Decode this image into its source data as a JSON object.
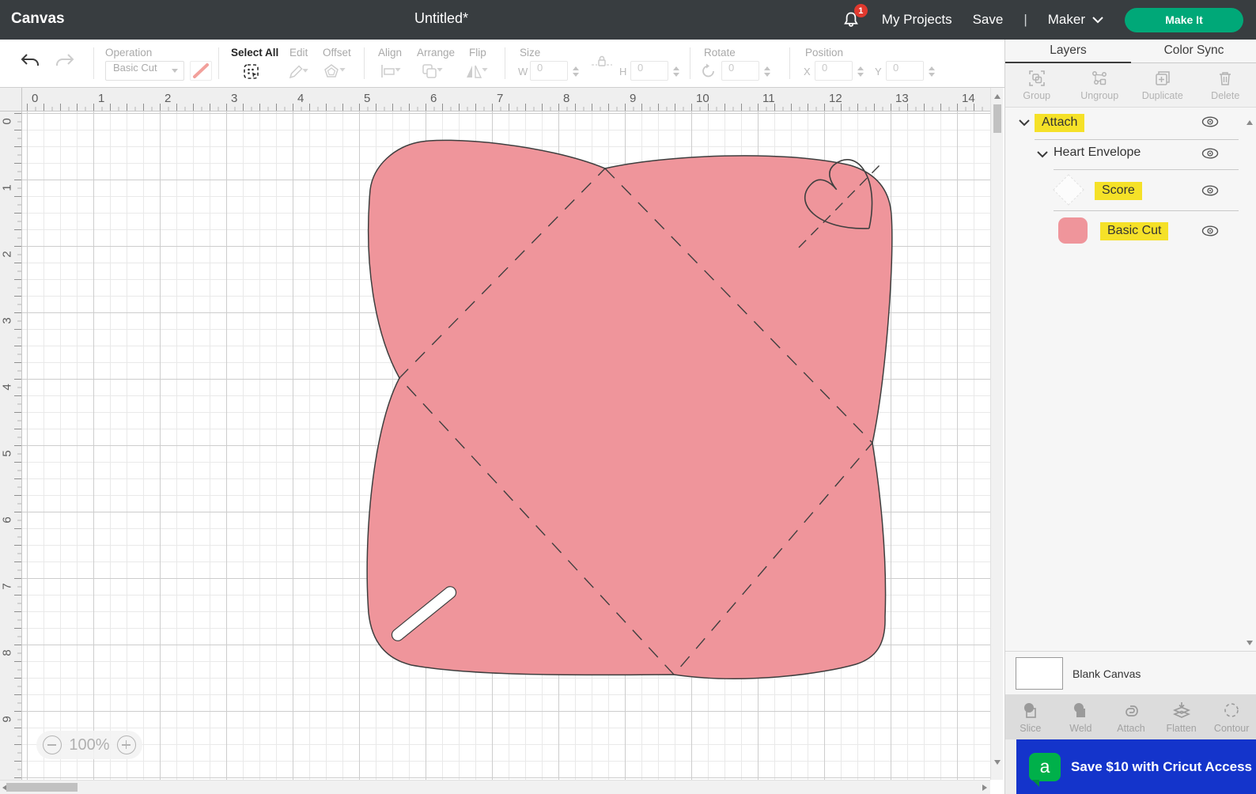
{
  "header": {
    "app_title": "Canvas",
    "doc_title": "Untitled*",
    "notification_count": "1",
    "my_projects": "My Projects",
    "save": "Save",
    "separator": "|",
    "machine_name": "Maker",
    "make_it": "Make It"
  },
  "toolbar": {
    "operation_label": "Operation",
    "operation_value": "Basic Cut",
    "select_all": "Select All",
    "edit": "Edit",
    "offset": "Offset",
    "align": "Align",
    "arrange": "Arrange",
    "flip": "Flip",
    "size_label": "Size",
    "w_label": "W",
    "w_value": "0",
    "h_label": "H",
    "h_value": "0",
    "rotate_label": "Rotate",
    "rotate_value": "0",
    "position_label": "Position",
    "x_label": "X",
    "x_value": "0",
    "y_label": "Y",
    "y_value": "0"
  },
  "canvas": {
    "zoom_level": "100%",
    "ruler_h": [
      "0",
      "1",
      "2",
      "3",
      "4",
      "5",
      "6",
      "7",
      "8",
      "9",
      "10",
      "11",
      "12",
      "13",
      "14"
    ],
    "ruler_v": [
      "0",
      "1",
      "2",
      "3",
      "4",
      "5",
      "6",
      "7",
      "8",
      "9"
    ],
    "object_name": "Heart Envelope"
  },
  "panel": {
    "tabs": [
      {
        "label": "Layers"
      },
      {
        "label": "Color Sync"
      }
    ],
    "actions": [
      {
        "label": "Group"
      },
      {
        "label": "Ungroup"
      },
      {
        "label": "Duplicate"
      },
      {
        "label": "Delete"
      }
    ],
    "layers": [
      {
        "label": "Attach",
        "highlighted": true
      },
      {
        "label": "Heart Envelope",
        "highlighted": false
      },
      {
        "label": "Score",
        "highlighted": true
      },
      {
        "label": "Basic Cut",
        "highlighted": true
      }
    ],
    "blank_canvas": "Blank Canvas",
    "tools": [
      {
        "label": "Slice"
      },
      {
        "label": "Weld"
      },
      {
        "label": "Attach"
      },
      {
        "label": "Flatten"
      },
      {
        "label": "Contour"
      }
    ],
    "banner": {
      "logo_letter": "a",
      "text": "Save $10 with Cricut Access"
    }
  },
  "colors": {
    "header_bg": "#383d40",
    "accent_green": "#00a878",
    "badge_red": "#e0392e",
    "banner_blue": "#1434cb",
    "logo_green": "#00b04a",
    "highlight_yellow": "#f5e128",
    "shape_pink": "#ef959b",
    "shape_stroke": "#3f3f3f"
  }
}
